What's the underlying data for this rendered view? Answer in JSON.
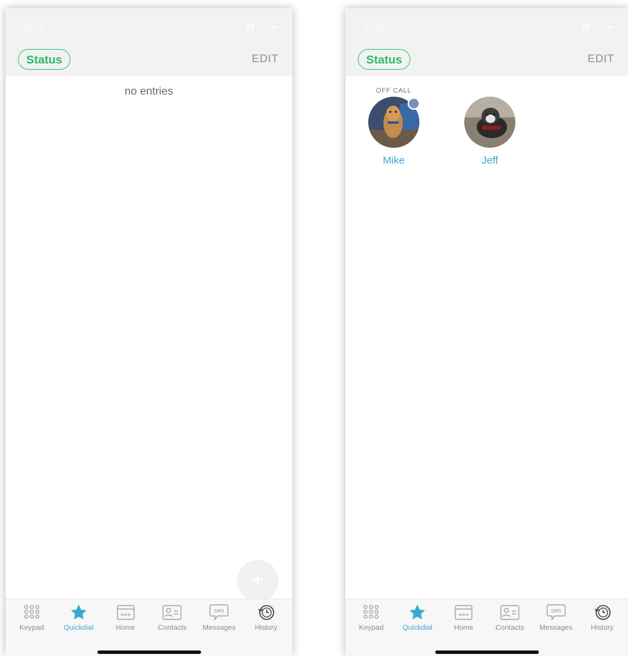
{
  "screens": [
    {
      "time": "4:24",
      "header": {
        "status_label": "Status",
        "edit_label": "EDIT"
      },
      "empty_text": "no entries",
      "fab_label": "+",
      "favorites": []
    },
    {
      "time": "4:28",
      "header": {
        "status_label": "Status",
        "edit_label": "EDIT"
      },
      "empty_text": "",
      "favorites": [
        {
          "name": "Mike",
          "status": "OFF CALL",
          "presence_color": "#7a8fb5"
        },
        {
          "name": "Jeff",
          "status": ""
        }
      ]
    }
  ],
  "tabs": [
    {
      "label": "Keypad",
      "icon": "keypad-icon"
    },
    {
      "label": "Quickdial",
      "icon": "star-icon",
      "active": true
    },
    {
      "label": "Home",
      "icon": "www-icon"
    },
    {
      "label": "Contacts",
      "icon": "contact-card-icon"
    },
    {
      "label": "Messages",
      "icon": "sms-icon"
    },
    {
      "label": "History",
      "icon": "history-clock-icon"
    }
  ],
  "colors": {
    "accent_green": "#3cc675",
    "accent_blue": "#3aa8d3",
    "presence_offcall": "#7a8fb5"
  }
}
